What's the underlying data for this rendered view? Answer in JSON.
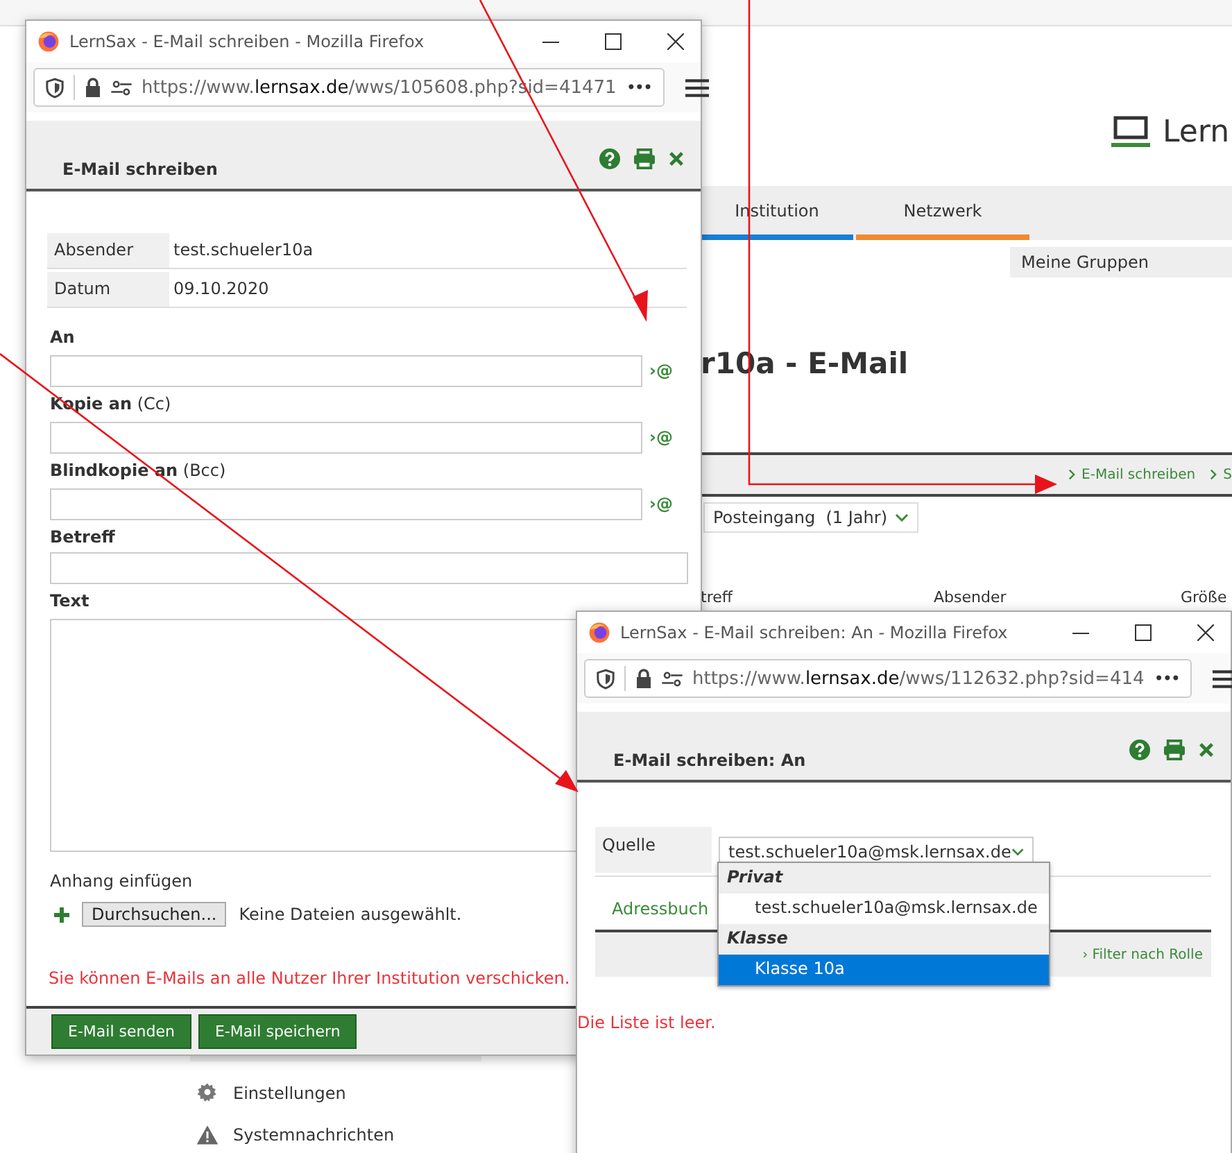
{
  "background_page": {
    "logo": "Lern",
    "tabs": [
      {
        "label": "Institution",
        "color": "#1a7fd4"
      },
      {
        "label": "Netzwerk",
        "color": "#f08a30"
      }
    ],
    "subnav": "Meine Gruppen",
    "heading": "r10a - E-Mail",
    "breadcrumbs": [
      "E-Mail schreiben",
      "S"
    ],
    "folder_select": "Posteingang  (1 Jahr)",
    "columns": [
      "treff",
      "Absender",
      "Größe"
    ],
    "sidebar_items": [
      {
        "label": "Einstellungen",
        "kind": "gear"
      },
      {
        "label": "Systemnachrichten",
        "kind": "warning"
      }
    ]
  },
  "compose_window": {
    "title": "LernSax - E-Mail schreiben - Mozilla Firefox",
    "url": {
      "scheme": "https://www.",
      "domain": "lernsax.de",
      "path": "/wws/105608.php?sid=41471"
    },
    "more": "•••",
    "header": "E-Mail schreiben",
    "info": [
      {
        "label": "Absender",
        "value": "test.schueler10a"
      },
      {
        "label": "Datum",
        "value": "09.10.2020"
      }
    ],
    "fields": [
      {
        "kind": "recipient",
        "label": "**An**",
        "link": "›@"
      },
      {
        "kind": "recipient",
        "label": "**Kopie an** (Cc)",
        "link": "›@"
      },
      {
        "kind": "recipient",
        "label": "**Blindkopie an** (Bcc)",
        "link": "›@"
      },
      {
        "kind": "line",
        "label": "**Betreff**"
      },
      {
        "kind": "area",
        "label": "**Text**"
      }
    ],
    "attachment": {
      "label": "Anhang einfügen",
      "button": "Durchsuchen...",
      "status": "Keine Dateien ausgewählt."
    },
    "notice": "Sie können E-Mails an alle Nutzer Ihrer Institution verschicken.",
    "buttons": [
      "E-Mail senden",
      "E-Mail speichern"
    ]
  },
  "recipient_window": {
    "title": "LernSax - E-Mail schreiben: An - Mozilla Firefox",
    "url": {
      "scheme": "https://www.",
      "domain": "lernsax.de",
      "path": "/wws/112632.php?sid=414"
    },
    "more": "•••",
    "header": "E-Mail schreiben: An",
    "source": {
      "label": "Quelle",
      "value": "test.schueler10a@msk.lernsax.de",
      "expanded": true,
      "groups": [
        {
          "label": "Privat",
          "options": [
            {
              "label": "test.schueler10a@msk.lernsax.de",
              "selected": false
            }
          ]
        },
        {
          "label": "Klasse",
          "options": [
            {
              "label": "Klasse 10a",
              "selected": true
            }
          ]
        }
      ]
    },
    "tab": "Adressbuch",
    "filter": "› Filter nach Rolle",
    "empty": "Die Liste ist leer."
  }
}
